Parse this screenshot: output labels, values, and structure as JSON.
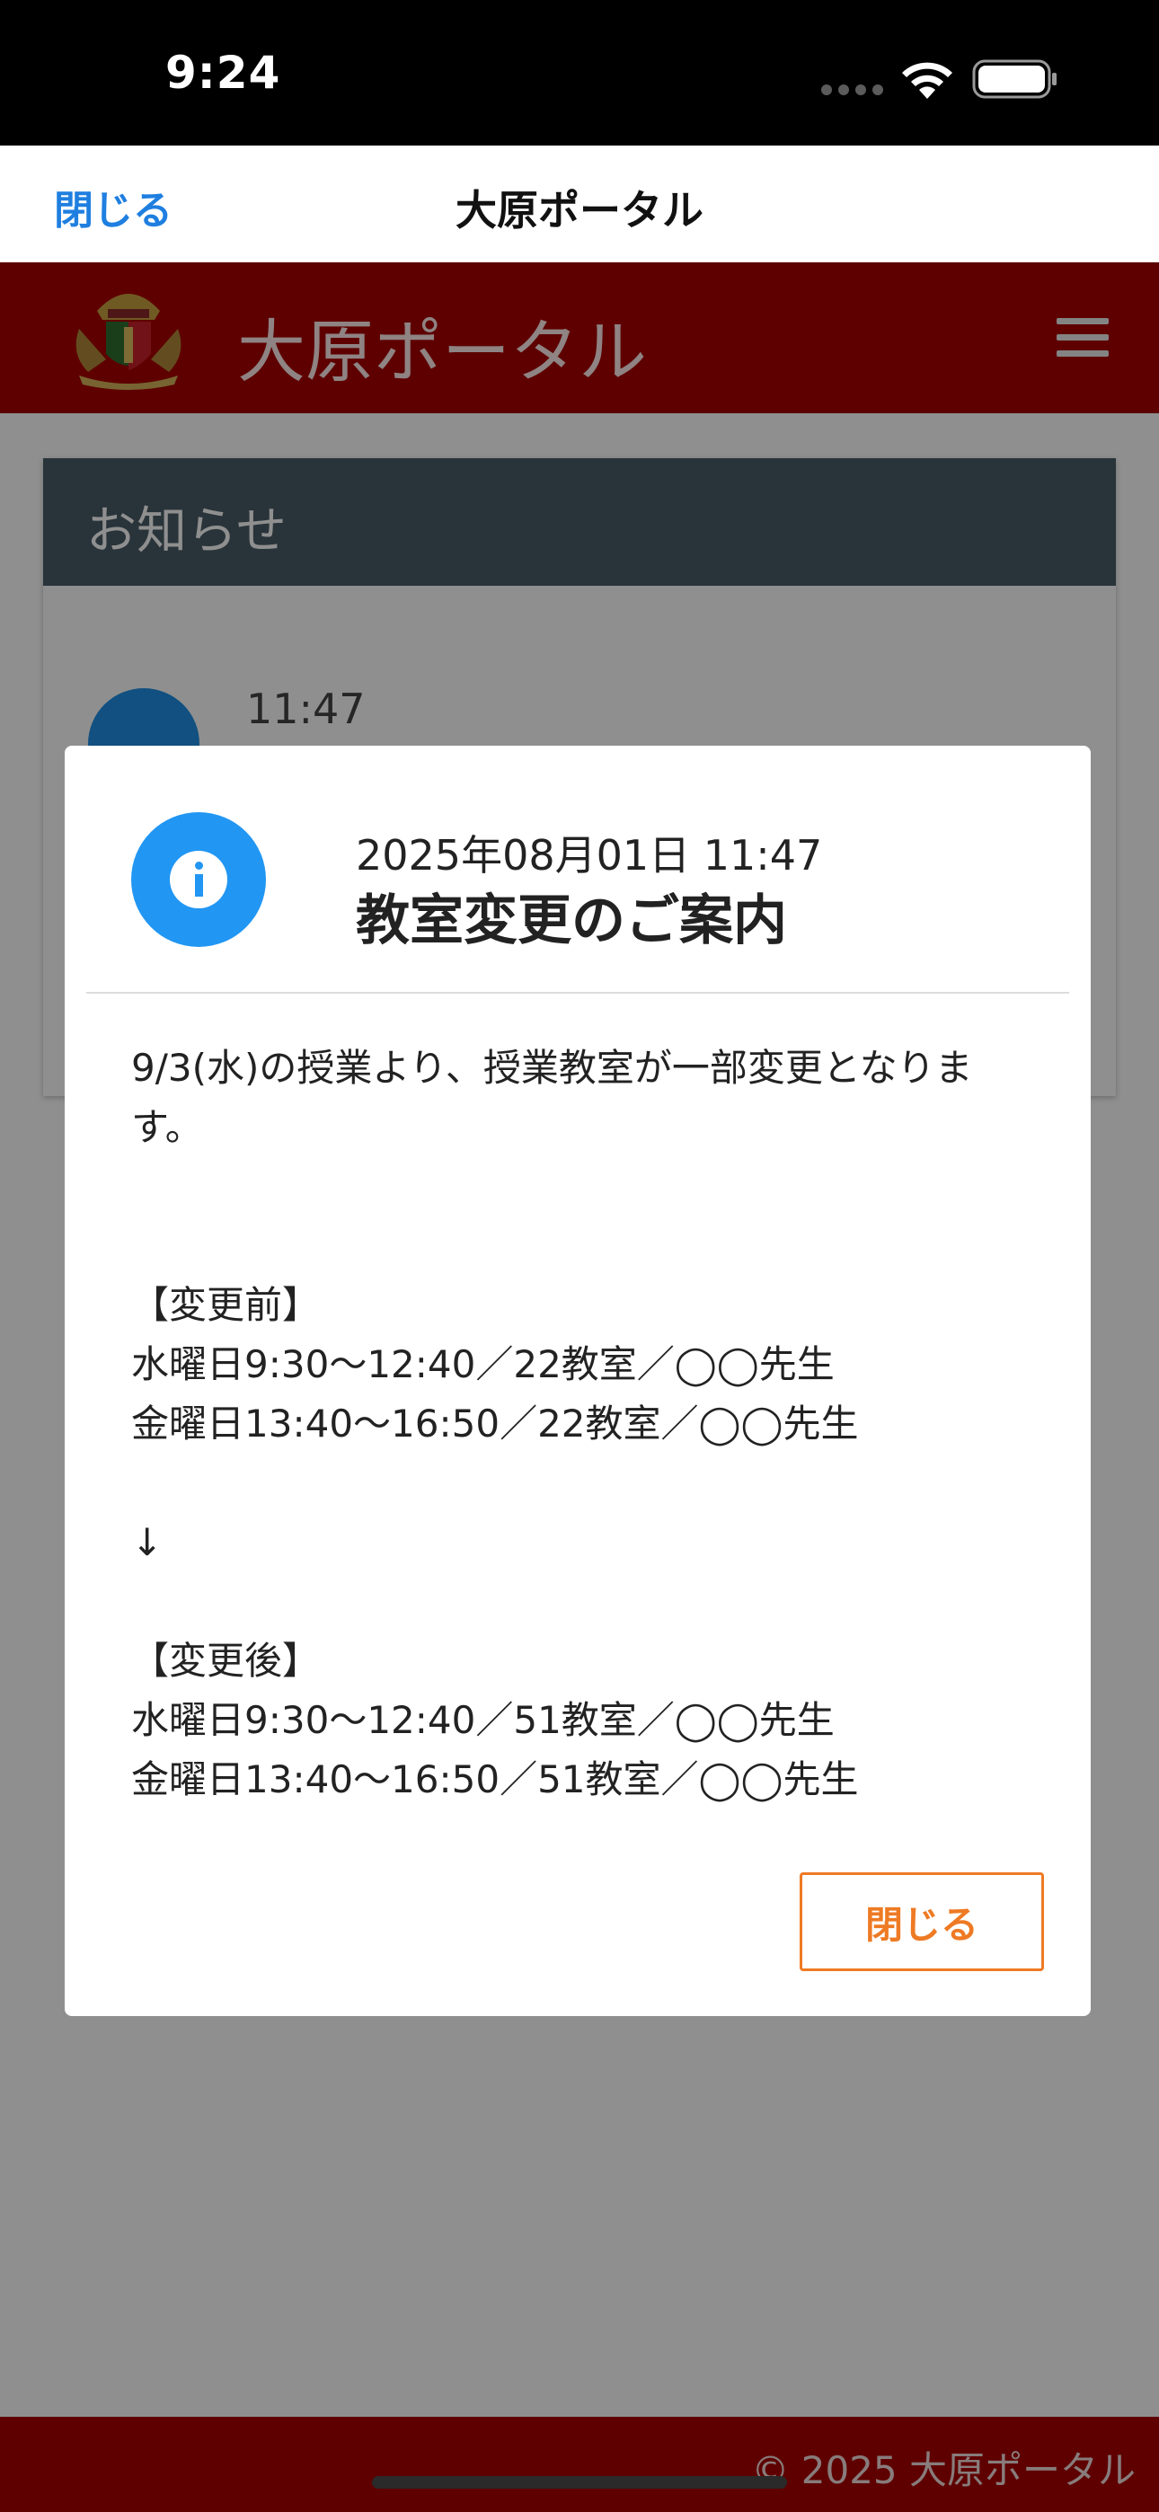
{
  "status_bar": {
    "time": "9:24"
  },
  "navbar": {
    "close_label": "閉じる",
    "title": "大原ポータル"
  },
  "app_header": {
    "title": "大原ポータル"
  },
  "notice_card": {
    "title": "お知らせ",
    "item_time": "11:47"
  },
  "modal": {
    "date": "2025年08月01日 11:47",
    "title": "教室変更のご案内",
    "body": [
      "9/3(水)の授業より、授業教室が一部変更となります。",
      "",
      "",
      "【変更前】",
      "水曜日9:30〜12:40／22教室／◯◯先生",
      "金曜日13:40〜16:50／22教室／◯◯先生",
      "",
      "↓",
      "",
      "【変更後】",
      "水曜日9:30〜12:40／51教室／◯◯先生",
      "金曜日13:40〜16:50／51教室／◯◯先生"
    ],
    "close_label": "閉じる"
  },
  "footer": {
    "text": "© 2025 大原ポータル"
  },
  "colors": {
    "header_red": "#a80000",
    "card_header": "#4a5d68",
    "info_blue": "#2196f3",
    "accent_orange": "#ee7a24",
    "link_blue": "#1f7fe0"
  },
  "icons": {
    "signal": "cellular-signal-icon",
    "wifi": "wifi-icon",
    "battery": "battery-icon",
    "crest": "school-crest-icon",
    "menu": "hamburger-menu-icon",
    "info": "info-icon"
  }
}
